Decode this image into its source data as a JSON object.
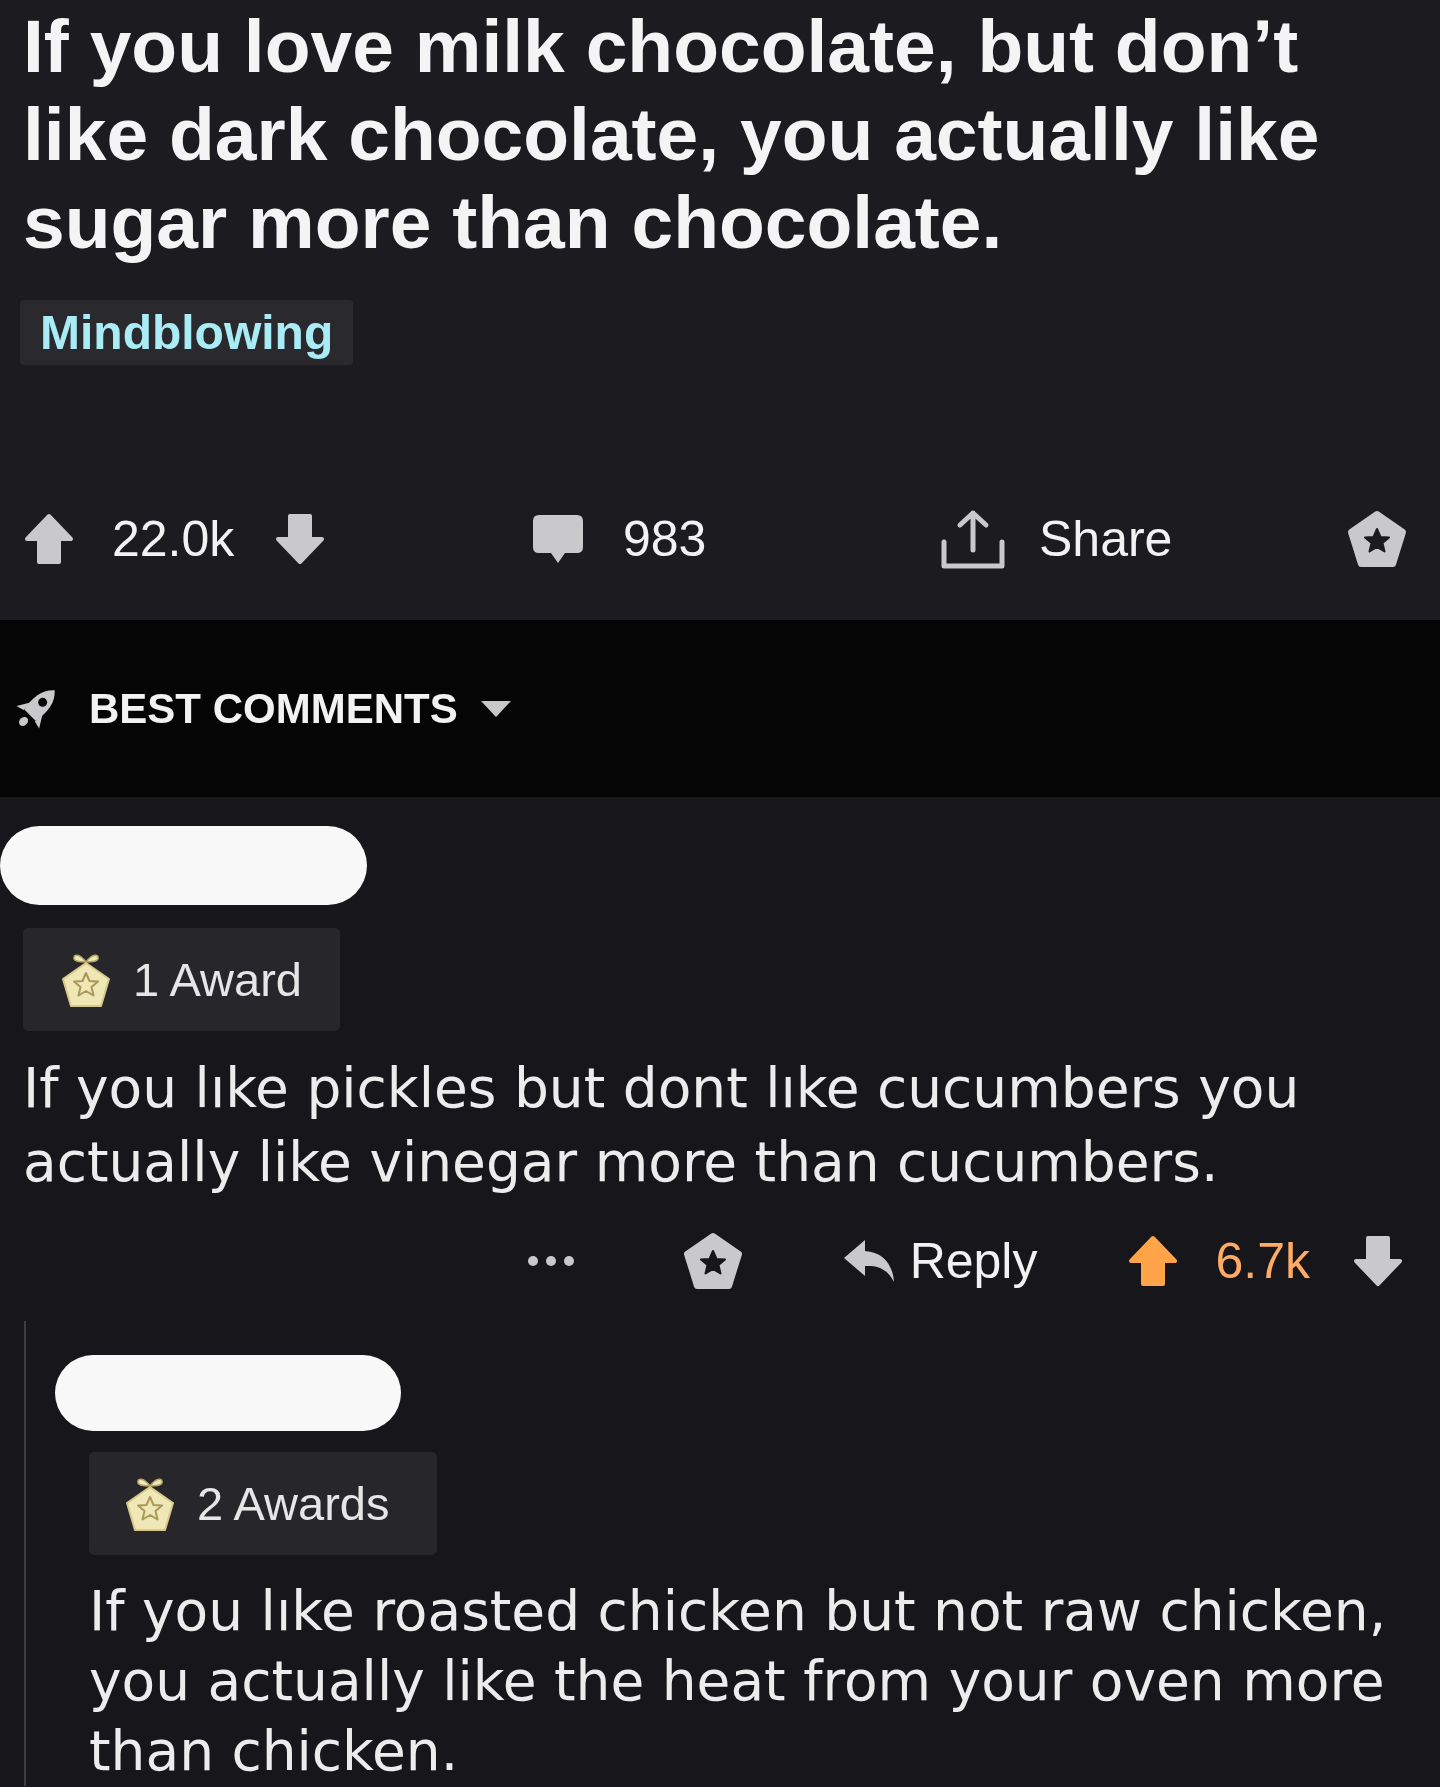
{
  "post": {
    "title": "If you love milk chocolate, but don’t like dark chocolate, you actually like sugar more than chocolate.",
    "flair": "Mindblowing",
    "actions": {
      "upvoted": false,
      "score": "22.0k",
      "comments": "983",
      "share": "Share"
    }
  },
  "sort": {
    "label": "BEST COMMENTS"
  },
  "comments": [
    {
      "awards": "1 Award",
      "body": "If you lıke pickles but dont lıke cucumbers you actually like vinegar more than cucumbers.",
      "actions": {
        "reply": "Reply",
        "upvoted": true,
        "score": "6.7k"
      },
      "children": [
        {
          "awards": "2 Awards",
          "body": "If you lıke roasted chicken but not raw chicken, you actually like the heat from your oven more than chicken."
        }
      ]
    }
  ]
}
